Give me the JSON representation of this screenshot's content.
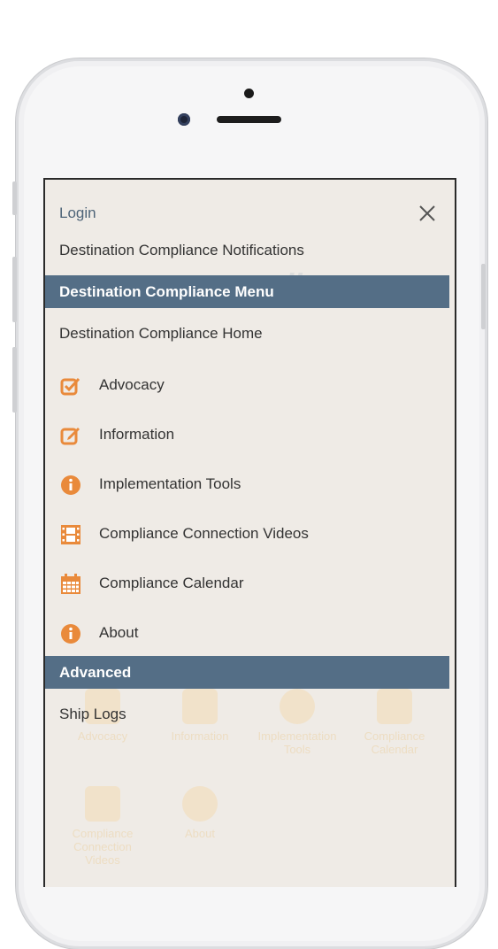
{
  "menu": {
    "login": "Login",
    "notifications": "Destination Compliance Notifications",
    "menu_header": "Destination Compliance Menu",
    "home": "Destination Compliance Home",
    "items": [
      {
        "label": "Advocacy",
        "icon": "checkbox-icon"
      },
      {
        "label": "Information",
        "icon": "edit-icon"
      },
      {
        "label": "Implementation Tools",
        "icon": "info-icon"
      },
      {
        "label": "Compliance Connection Videos",
        "icon": "film-icon"
      },
      {
        "label": "Compliance Calendar",
        "icon": "calendar-icon"
      },
      {
        "label": "About",
        "icon": "info-icon"
      }
    ],
    "advanced_header": "Advanced",
    "ship_logs": "Ship Logs"
  },
  "background": {
    "logo_text": "ompliance",
    "tiles": [
      "Advocacy",
      "Information",
      "Implementation Tools",
      "Compliance Calendar",
      "Compliance Connection Videos",
      "About"
    ]
  },
  "colors": {
    "header_bg": "#546e86",
    "icon_orange": "#e98a3b",
    "text": "#333333",
    "login_text": "#4e6478"
  }
}
